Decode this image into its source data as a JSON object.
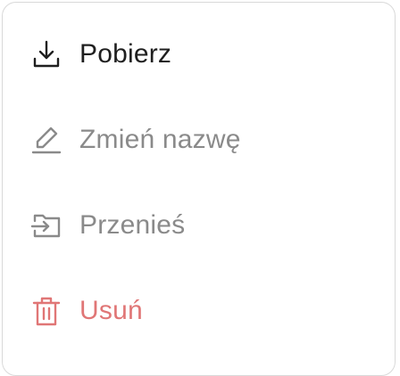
{
  "menu": {
    "items": [
      {
        "key": "download",
        "label": "Pobierz",
        "icon": "download-icon",
        "color": "#1f1f1f",
        "enabled": true
      },
      {
        "key": "rename",
        "label": "Zmień nazwę",
        "icon": "pencil-icon",
        "color": "#8a8a8a",
        "enabled": false
      },
      {
        "key": "move",
        "label": "Przenieś",
        "icon": "folder-move-icon",
        "color": "#8a8a8a",
        "enabled": false
      },
      {
        "key": "delete",
        "label": "Usuń",
        "icon": "trash-icon",
        "color": "#e07676",
        "enabled": true
      }
    ]
  }
}
